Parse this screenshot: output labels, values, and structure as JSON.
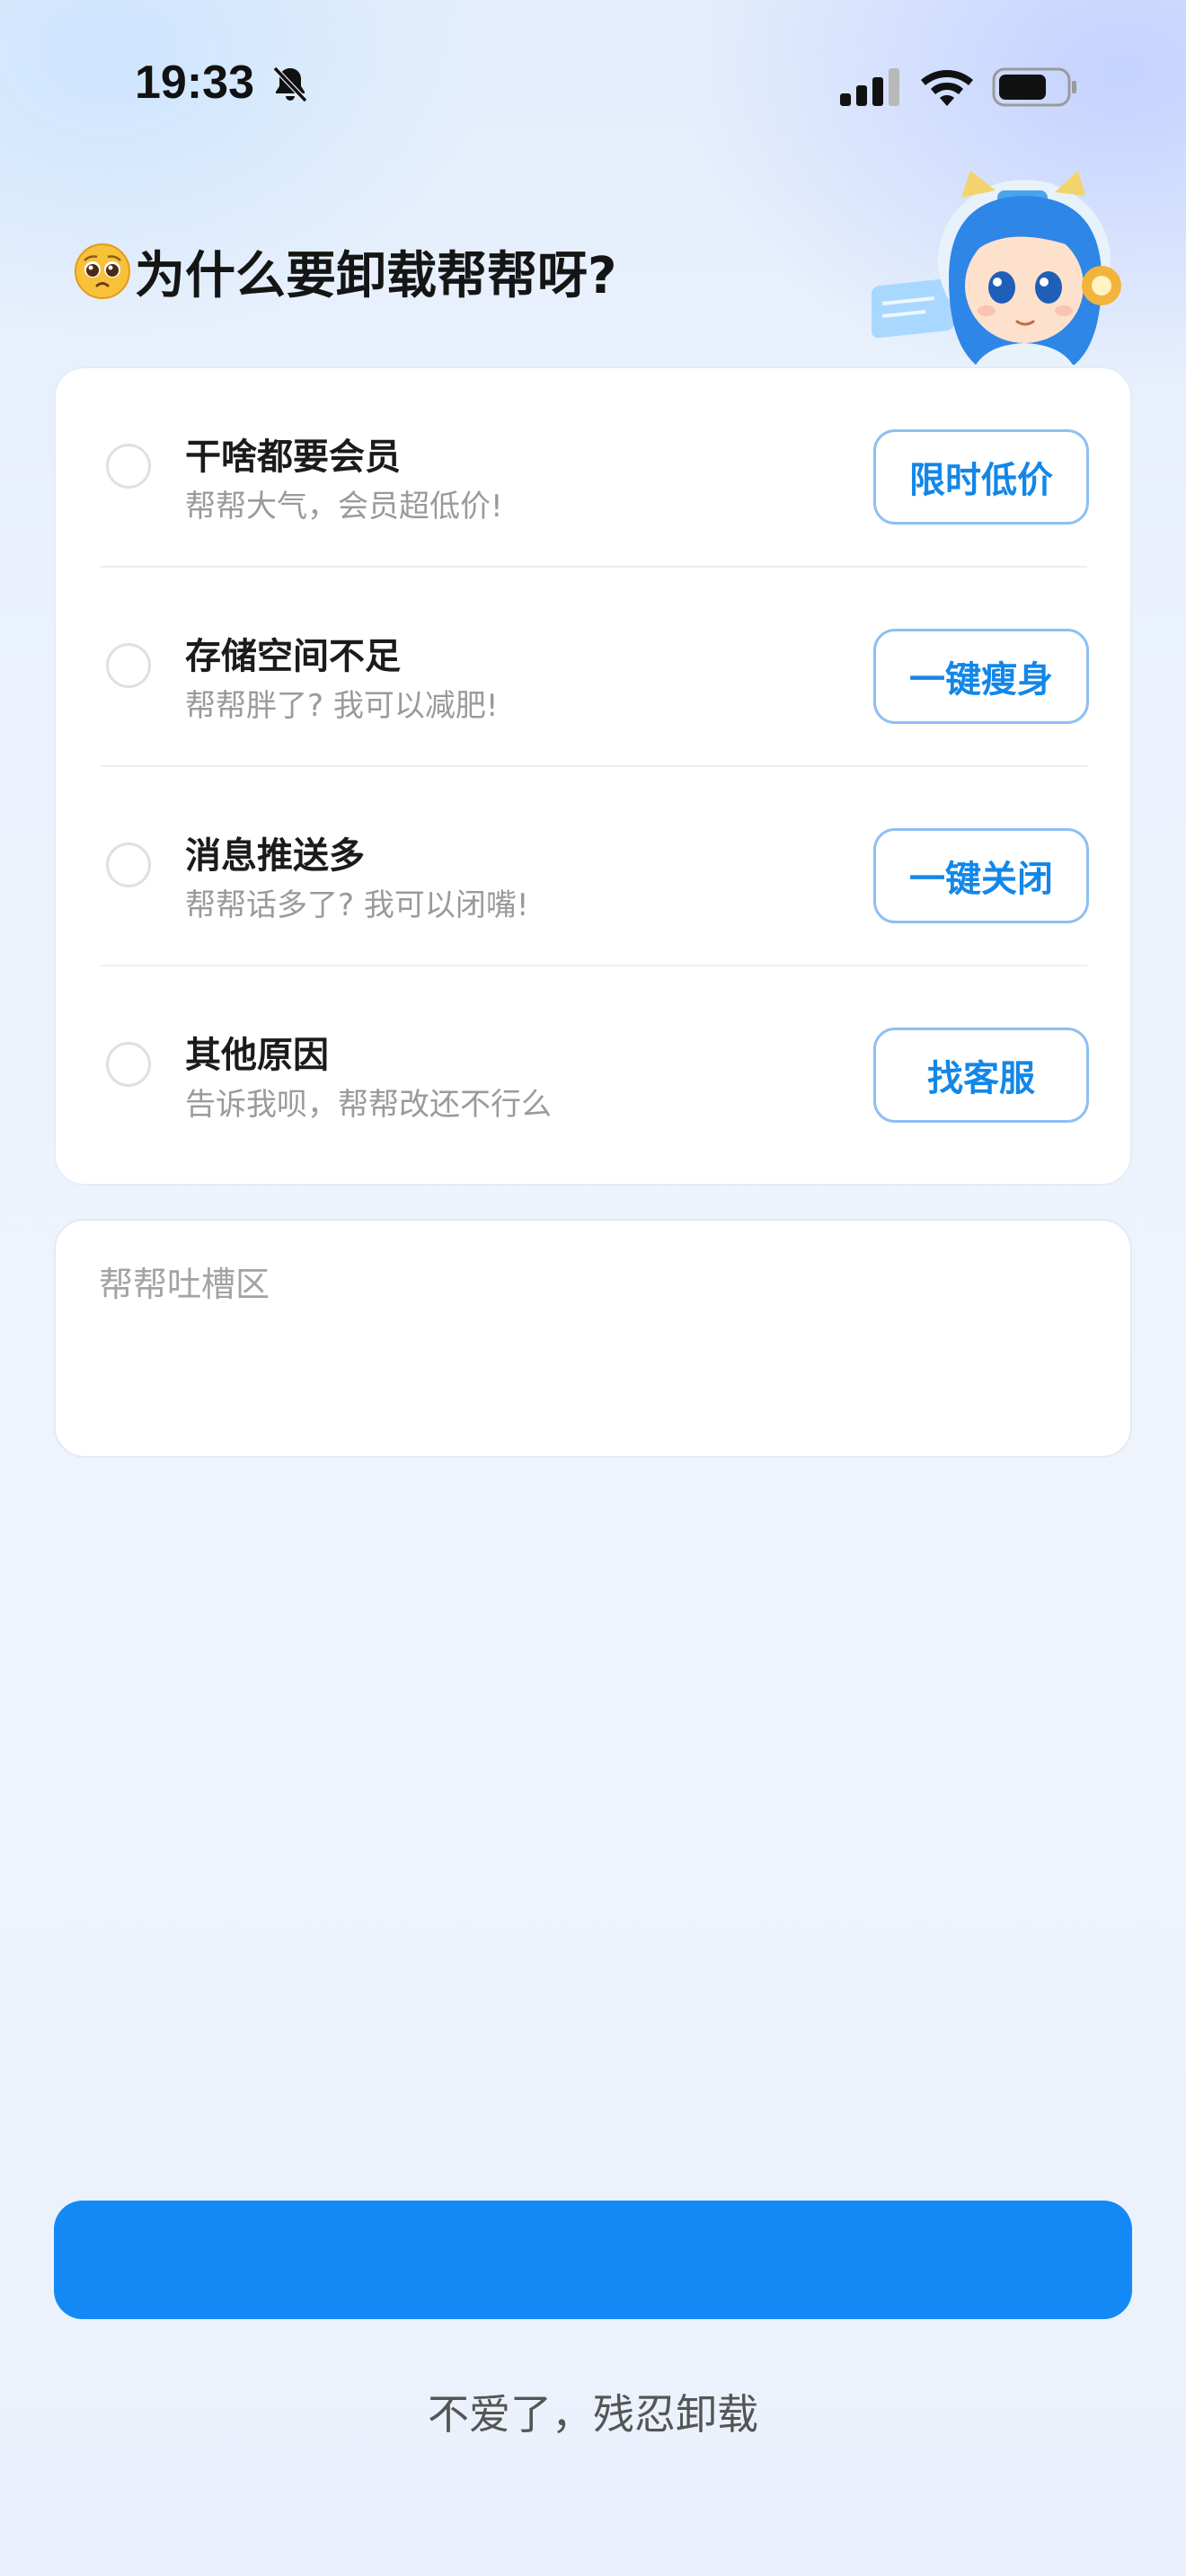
{
  "status_bar": {
    "time": "19:33",
    "icons": [
      "bell-slash-icon",
      "signal-icon",
      "wifi-icon",
      "battery-icon"
    ]
  },
  "header": {
    "emoji": "pleading-face-emoji",
    "title": "为什么要卸载帮帮呀?",
    "mascot": "mascot-illustration"
  },
  "reasons": [
    {
      "title": "干啥都要会员",
      "subtitle": "帮帮大气，会员超低价!",
      "action": "限时低价",
      "selected": false
    },
    {
      "title": "存储空间不足",
      "subtitle": "帮帮胖了? 我可以减肥!",
      "action": "一键瘦身",
      "selected": false
    },
    {
      "title": "消息推送多",
      "subtitle": "帮帮话多了? 我可以闭嘴!",
      "action": "一键关闭",
      "selected": false
    },
    {
      "title": "其他原因",
      "subtitle": "告诉我呗，帮帮改还不行么",
      "action": "找客服",
      "selected": false
    }
  ],
  "feedback": {
    "value": "",
    "placeholder": "帮帮吐槽区"
  },
  "primary_button": {
    "label": ""
  },
  "uninstall_link": {
    "label": "不爱了，残忍卸载"
  },
  "colors": {
    "accent": "#1389f6",
    "button_border": "#8ec0f2",
    "button_text": "#1387e8",
    "subtitle": "#9a9a9a"
  }
}
